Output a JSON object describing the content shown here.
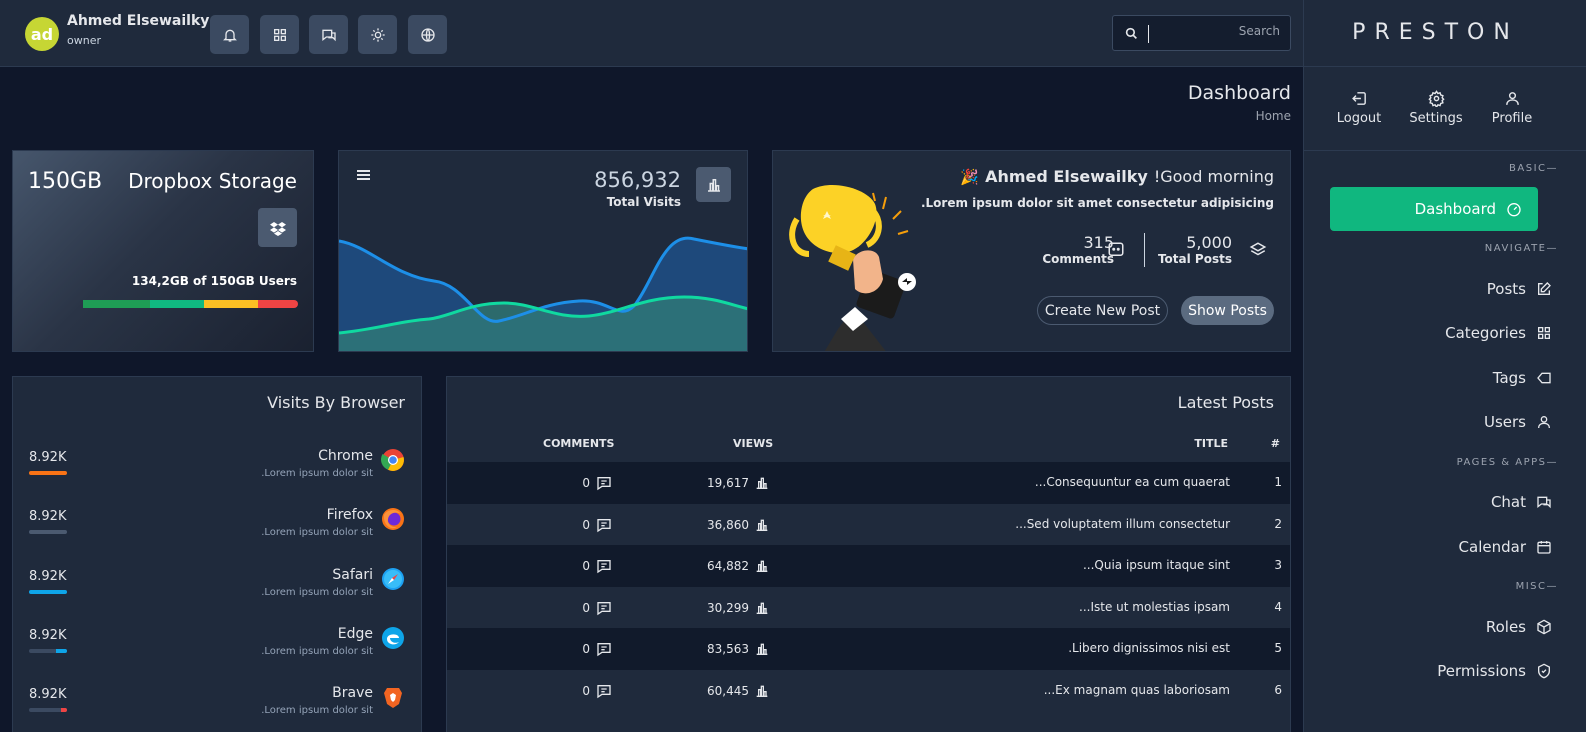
{
  "user": {
    "initials": "ad",
    "name": "Ahmed Elsewailky",
    "role": "owner"
  },
  "topbar_icons": [
    "bell-icon",
    "grid-icon",
    "chat-icon",
    "sun-icon",
    "globe-icon"
  ],
  "search": {
    "placeholder": "Search",
    "value": ""
  },
  "brand": "PRESTON",
  "quick_actions": {
    "logout": "Logout",
    "settings": "Settings",
    "profile": "Profile"
  },
  "sidebar": {
    "sections": {
      "basic": "BASIC—",
      "navigate": "NAVIGATE—",
      "pages": "PAGES & APPS—",
      "misc": "MISC—"
    },
    "dashboard": "Dashboard",
    "posts": "Posts",
    "categories": "Categories",
    "tags": "Tags",
    "users": "Users",
    "chat": "Chat",
    "calendar": "Calendar",
    "roles": "Roles",
    "permissions": "Permissions"
  },
  "page": {
    "title": "Dashboard",
    "breadcrumb": "Home"
  },
  "storage": {
    "size": "150GB",
    "title": "Dropbox Storage",
    "usage": "134,2GB of 150GB Users",
    "bar_colors": [
      "#1f9d55",
      "#10b981",
      "#fbbf24",
      "#ef4444"
    ]
  },
  "visits": {
    "value": "856,932",
    "label": "Total Visits"
  },
  "welcome": {
    "greeting_name": "Ahmed Elsewailky",
    "greeting": "!Good morning",
    "subtitle": ".Lorem ipsum dolor sit amet consectetur adipisicing",
    "comments_value": "315",
    "comments_label": "Comments",
    "posts_value": "5,000",
    "posts_label": "Total Posts",
    "create_button": "Create New Post",
    "show_button": "Show Posts"
  },
  "browsers": {
    "title": "Visits By Browser",
    "items": [
      {
        "value": "8.92K",
        "name": "Chrome",
        "desc": ".Lorem ipsum dolor sit",
        "bar_color": "#f97316",
        "fill": 1.0
      },
      {
        "value": "8.92K",
        "name": "Firefox",
        "desc": ".Lorem ipsum dolor sit",
        "bar_color": "#4b5a70",
        "fill": 1.0
      },
      {
        "value": "8.92K",
        "name": "Safari",
        "desc": ".Lorem ipsum dolor sit",
        "bar_color": "#0ea5e9",
        "fill": 1.0
      },
      {
        "value": "8.92K",
        "name": "Edge",
        "desc": ".Lorem ipsum dolor sit",
        "bar_color": "#0ea5e9",
        "fill": 0.3
      },
      {
        "value": "8.92K",
        "name": "Brave",
        "desc": ".Lorem ipsum dolor sit",
        "bar_color": "#ef4444",
        "fill": 0.15
      }
    ]
  },
  "posts": {
    "title": "Latest Posts",
    "headers": {
      "comments": "COMMENTS",
      "views": "VIEWS",
      "title": "TITLE",
      "num": "#"
    },
    "rows": [
      {
        "comments": "0",
        "views": "19,617",
        "title": "...Consequuntur ea cum quaerat",
        "num": "1"
      },
      {
        "comments": "0",
        "views": "36,860",
        "title": "...Sed voluptatem illum consectetur",
        "num": "2"
      },
      {
        "comments": "0",
        "views": "64,882",
        "title": "...Quia ipsum itaque sint",
        "num": "3"
      },
      {
        "comments": "0",
        "views": "30,299",
        "title": "...Iste ut molestias ipsam",
        "num": "4"
      },
      {
        "comments": "0",
        "views": "83,563",
        "title": ".Libero dignissimos nisi est",
        "num": "5"
      },
      {
        "comments": "0",
        "views": "60,445",
        "title": "...Ex magnam quas laboriosam",
        "num": "6"
      }
    ]
  }
}
